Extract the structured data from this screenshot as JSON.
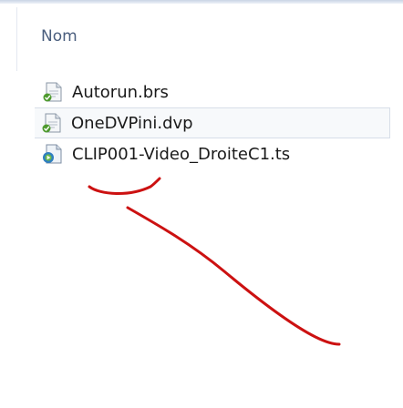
{
  "header": {
    "column_name": "Nom"
  },
  "files": [
    {
      "name": "Autorun.brs",
      "icon": "script-file-icon"
    },
    {
      "name": "OneDVPini.dvp",
      "icon": "script-file-icon"
    },
    {
      "name": "CLIP001-Video_DroiteC1.ts",
      "icon": "media-file-icon"
    }
  ],
  "colors": {
    "annotation": "#cc1111",
    "header_text": "#4a5e7e",
    "row_highlight_border": "#d7dee8"
  }
}
